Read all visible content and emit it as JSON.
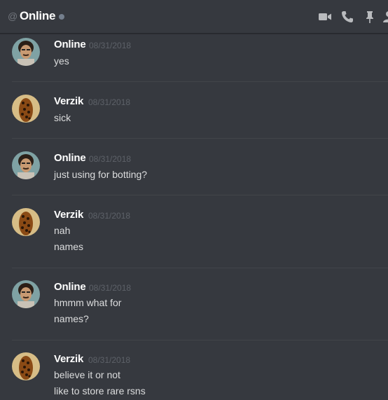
{
  "header": {
    "at_symbol": "@",
    "title": "Online",
    "icons": [
      "video-call-icon",
      "phone-call-icon",
      "pin-icon",
      "add-member-icon"
    ]
  },
  "messages": [
    {
      "author": "Online",
      "timestamp": "08/31/2018",
      "lines": [
        "yes"
      ]
    },
    {
      "author": "Verzik",
      "timestamp": "08/31/2018",
      "lines": [
        "sick"
      ]
    },
    {
      "author": "Online",
      "timestamp": "08/31/2018",
      "lines": [
        "just using for botting?"
      ]
    },
    {
      "author": "Verzik",
      "timestamp": "08/31/2018",
      "lines": [
        "nah",
        "names"
      ]
    },
    {
      "author": "Online",
      "timestamp": "08/31/2018",
      "lines": [
        "hmmm what for",
        "names?"
      ]
    },
    {
      "author": "Verzik",
      "timestamp": "08/31/2018",
      "lines": [
        "believe it or not",
        "like to store rare rsns"
      ]
    }
  ],
  "colors": {
    "background": "#36393f",
    "username": "#ffffff",
    "timestamp": "#5d6168",
    "message_text": "#dcddde",
    "status_offline": "#747f8d"
  }
}
